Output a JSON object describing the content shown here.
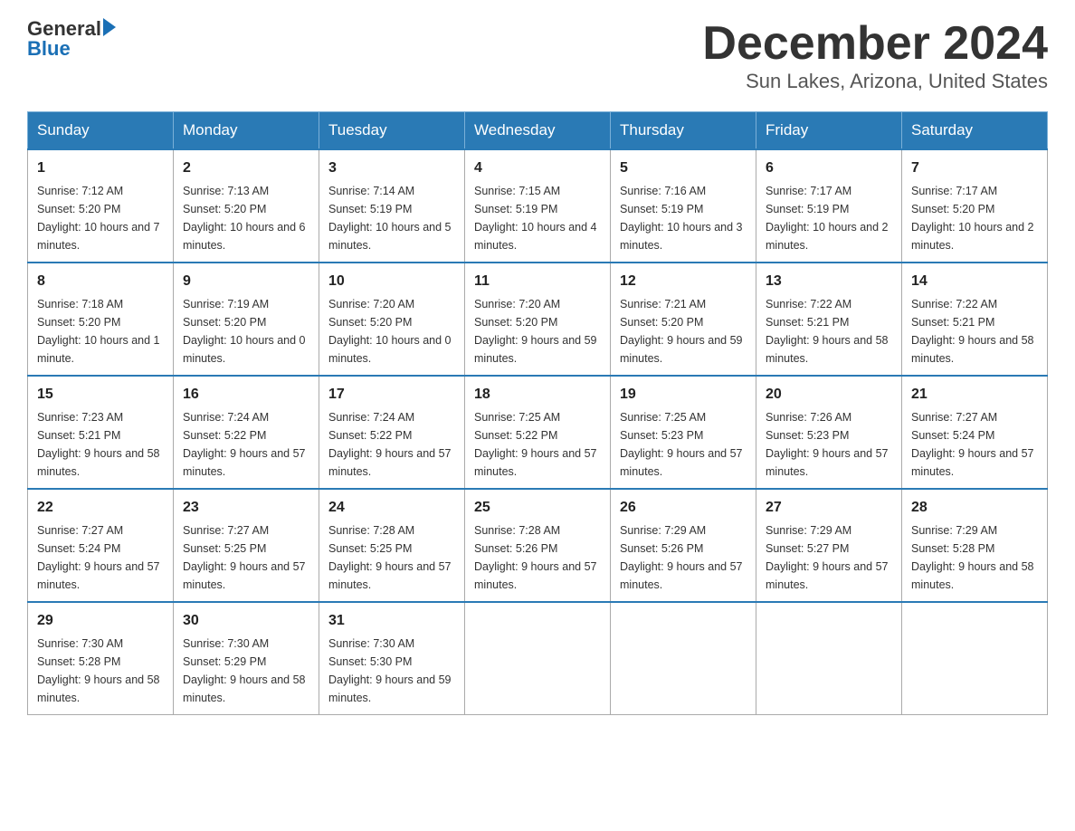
{
  "header": {
    "logo_text_general": "General",
    "logo_text_blue": "Blue",
    "month_title": "December 2024",
    "location": "Sun Lakes, Arizona, United States"
  },
  "days_of_week": [
    "Sunday",
    "Monday",
    "Tuesday",
    "Wednesday",
    "Thursday",
    "Friday",
    "Saturday"
  ],
  "weeks": [
    [
      {
        "day": "1",
        "sunrise": "7:12 AM",
        "sunset": "5:20 PM",
        "daylight": "10 hours and 7 minutes."
      },
      {
        "day": "2",
        "sunrise": "7:13 AM",
        "sunset": "5:20 PM",
        "daylight": "10 hours and 6 minutes."
      },
      {
        "day": "3",
        "sunrise": "7:14 AM",
        "sunset": "5:19 PM",
        "daylight": "10 hours and 5 minutes."
      },
      {
        "day": "4",
        "sunrise": "7:15 AM",
        "sunset": "5:19 PM",
        "daylight": "10 hours and 4 minutes."
      },
      {
        "day": "5",
        "sunrise": "7:16 AM",
        "sunset": "5:19 PM",
        "daylight": "10 hours and 3 minutes."
      },
      {
        "day": "6",
        "sunrise": "7:17 AM",
        "sunset": "5:19 PM",
        "daylight": "10 hours and 2 minutes."
      },
      {
        "day": "7",
        "sunrise": "7:17 AM",
        "sunset": "5:20 PM",
        "daylight": "10 hours and 2 minutes."
      }
    ],
    [
      {
        "day": "8",
        "sunrise": "7:18 AM",
        "sunset": "5:20 PM",
        "daylight": "10 hours and 1 minute."
      },
      {
        "day": "9",
        "sunrise": "7:19 AM",
        "sunset": "5:20 PM",
        "daylight": "10 hours and 0 minutes."
      },
      {
        "day": "10",
        "sunrise": "7:20 AM",
        "sunset": "5:20 PM",
        "daylight": "10 hours and 0 minutes."
      },
      {
        "day": "11",
        "sunrise": "7:20 AM",
        "sunset": "5:20 PM",
        "daylight": "9 hours and 59 minutes."
      },
      {
        "day": "12",
        "sunrise": "7:21 AM",
        "sunset": "5:20 PM",
        "daylight": "9 hours and 59 minutes."
      },
      {
        "day": "13",
        "sunrise": "7:22 AM",
        "sunset": "5:21 PM",
        "daylight": "9 hours and 58 minutes."
      },
      {
        "day": "14",
        "sunrise": "7:22 AM",
        "sunset": "5:21 PM",
        "daylight": "9 hours and 58 minutes."
      }
    ],
    [
      {
        "day": "15",
        "sunrise": "7:23 AM",
        "sunset": "5:21 PM",
        "daylight": "9 hours and 58 minutes."
      },
      {
        "day": "16",
        "sunrise": "7:24 AM",
        "sunset": "5:22 PM",
        "daylight": "9 hours and 57 minutes."
      },
      {
        "day": "17",
        "sunrise": "7:24 AM",
        "sunset": "5:22 PM",
        "daylight": "9 hours and 57 minutes."
      },
      {
        "day": "18",
        "sunrise": "7:25 AM",
        "sunset": "5:22 PM",
        "daylight": "9 hours and 57 minutes."
      },
      {
        "day": "19",
        "sunrise": "7:25 AM",
        "sunset": "5:23 PM",
        "daylight": "9 hours and 57 minutes."
      },
      {
        "day": "20",
        "sunrise": "7:26 AM",
        "sunset": "5:23 PM",
        "daylight": "9 hours and 57 minutes."
      },
      {
        "day": "21",
        "sunrise": "7:27 AM",
        "sunset": "5:24 PM",
        "daylight": "9 hours and 57 minutes."
      }
    ],
    [
      {
        "day": "22",
        "sunrise": "7:27 AM",
        "sunset": "5:24 PM",
        "daylight": "9 hours and 57 minutes."
      },
      {
        "day": "23",
        "sunrise": "7:27 AM",
        "sunset": "5:25 PM",
        "daylight": "9 hours and 57 minutes."
      },
      {
        "day": "24",
        "sunrise": "7:28 AM",
        "sunset": "5:25 PM",
        "daylight": "9 hours and 57 minutes."
      },
      {
        "day": "25",
        "sunrise": "7:28 AM",
        "sunset": "5:26 PM",
        "daylight": "9 hours and 57 minutes."
      },
      {
        "day": "26",
        "sunrise": "7:29 AM",
        "sunset": "5:26 PM",
        "daylight": "9 hours and 57 minutes."
      },
      {
        "day": "27",
        "sunrise": "7:29 AM",
        "sunset": "5:27 PM",
        "daylight": "9 hours and 57 minutes."
      },
      {
        "day": "28",
        "sunrise": "7:29 AM",
        "sunset": "5:28 PM",
        "daylight": "9 hours and 58 minutes."
      }
    ],
    [
      {
        "day": "29",
        "sunrise": "7:30 AM",
        "sunset": "5:28 PM",
        "daylight": "9 hours and 58 minutes."
      },
      {
        "day": "30",
        "sunrise": "7:30 AM",
        "sunset": "5:29 PM",
        "daylight": "9 hours and 58 minutes."
      },
      {
        "day": "31",
        "sunrise": "7:30 AM",
        "sunset": "5:30 PM",
        "daylight": "9 hours and 59 minutes."
      },
      null,
      null,
      null,
      null
    ]
  ]
}
